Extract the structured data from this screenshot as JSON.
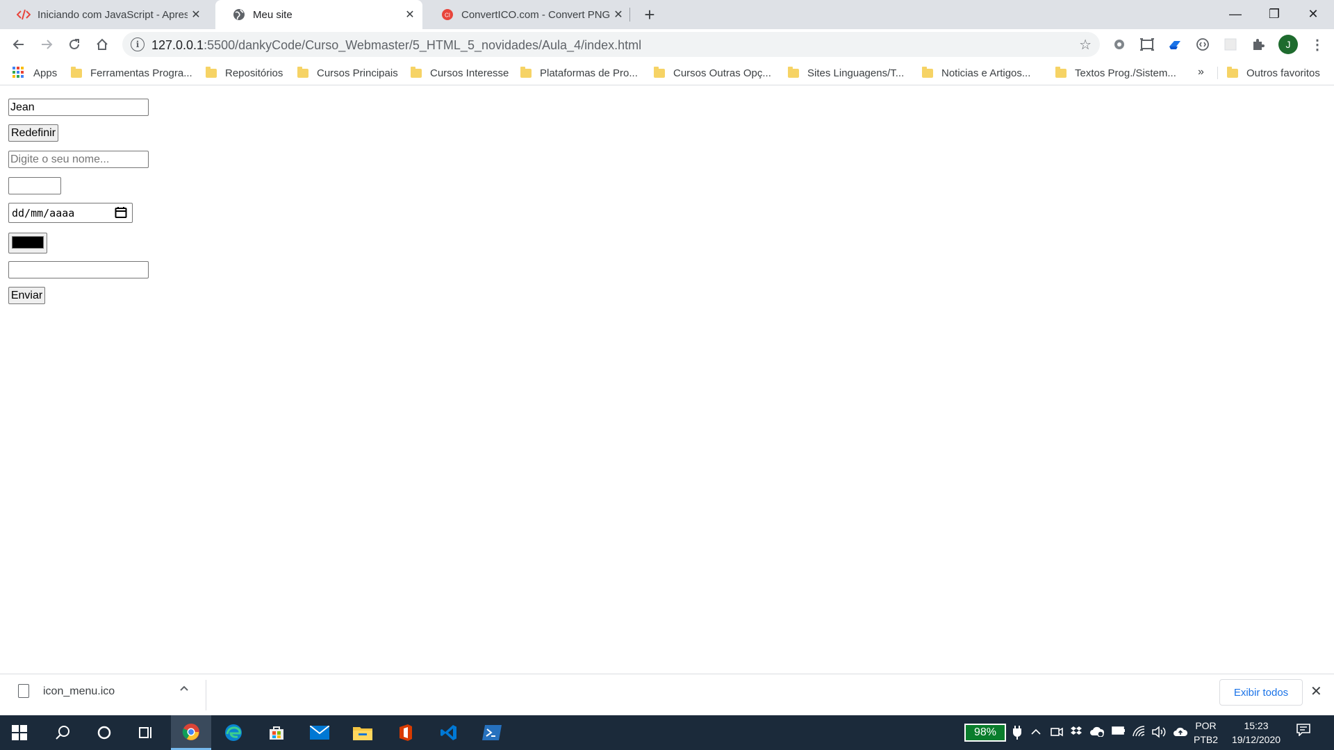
{
  "browser": {
    "tabs": [
      {
        "title": "Iniciando com JavaScript - Apresentação",
        "favicon": "code-icon",
        "active": false
      },
      {
        "title": "Meu site",
        "favicon": "globe-icon",
        "active": true
      },
      {
        "title": "ConvertICO.com - Convert PNG to ICO",
        "favicon": "converticon-icon",
        "active": false
      }
    ],
    "new_tab": "+",
    "window_controls": {
      "minimize": "—",
      "restore": "❐",
      "close": "✕"
    },
    "url_host": "127.0.0.1",
    "url_path": ":5500/dankyCode/Curso_Webmaster/5_HTML_5_novidades/Aula_4/index.html",
    "profile_initial": "J"
  },
  "bookmarks": {
    "apps_label": "Apps",
    "items": [
      "Ferramentas Progra...",
      "Repositórios",
      "Cursos Principais",
      "Cursos Interesse",
      "Plataformas de Pro...",
      "Cursos Outras Opç...",
      "Sites Linguagens/T...",
      "Noticias e Artigos...",
      "Textos Prog./Sistem..."
    ],
    "more": "»",
    "other": "Outros favoritos"
  },
  "form": {
    "name_value": "Jean",
    "reset_label": "Redefinir",
    "name_placeholder": "Digite o seu nome...",
    "number_value": "",
    "date_placeholder": "dd/mm/aaaa",
    "color_value": "#000000",
    "text_value": "",
    "submit_label": "Enviar"
  },
  "download": {
    "filename": "icon_menu.ico",
    "show_all": "Exibir todos"
  },
  "taskbar": {
    "battery": "98%",
    "lang_top": "POR",
    "lang_bottom": "PTB2",
    "time": "15:23",
    "date": "19/12/2020"
  },
  "colors": {
    "accent": "#1a73e8",
    "tabstrip": "#dee1e6",
    "taskbar": "#1b2a3a"
  }
}
